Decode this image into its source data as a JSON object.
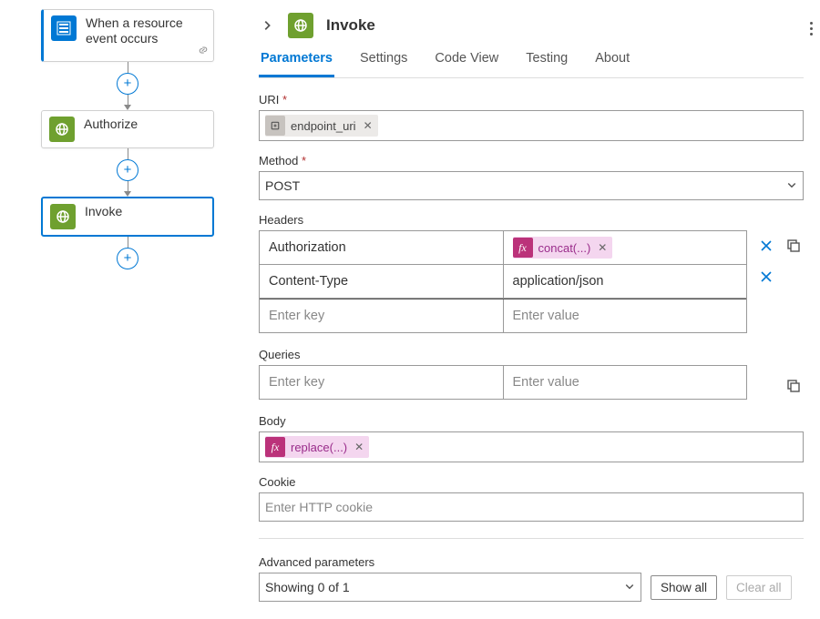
{
  "flow": {
    "node1_label": "When a resource event occurs",
    "node2_label": "Authorize",
    "node3_label": "Invoke"
  },
  "panel": {
    "title": "Invoke",
    "tabs": {
      "parameters": "Parameters",
      "settings": "Settings",
      "code_view": "Code View",
      "testing": "Testing",
      "about": "About"
    }
  },
  "form": {
    "uri_label": "URI",
    "uri_token": "endpoint_uri",
    "method_label": "Method",
    "method_value": "POST",
    "headers_label": "Headers",
    "headers": {
      "r1_key": "Authorization",
      "r1_val_token": "concat(...)",
      "r2_key": "Content-Type",
      "r2_val": "application/json",
      "ph_key": "Enter key",
      "ph_val": "Enter value"
    },
    "queries_label": "Queries",
    "queries": {
      "ph_key": "Enter key",
      "ph_val": "Enter value"
    },
    "body_label": "Body",
    "body_token": "replace(...)",
    "cookie_label": "Cookie",
    "cookie_placeholder": "Enter HTTP cookie",
    "adv_label": "Advanced parameters",
    "adv_value": "Showing 0 of 1",
    "show_all": "Show all",
    "clear_all": "Clear all"
  }
}
